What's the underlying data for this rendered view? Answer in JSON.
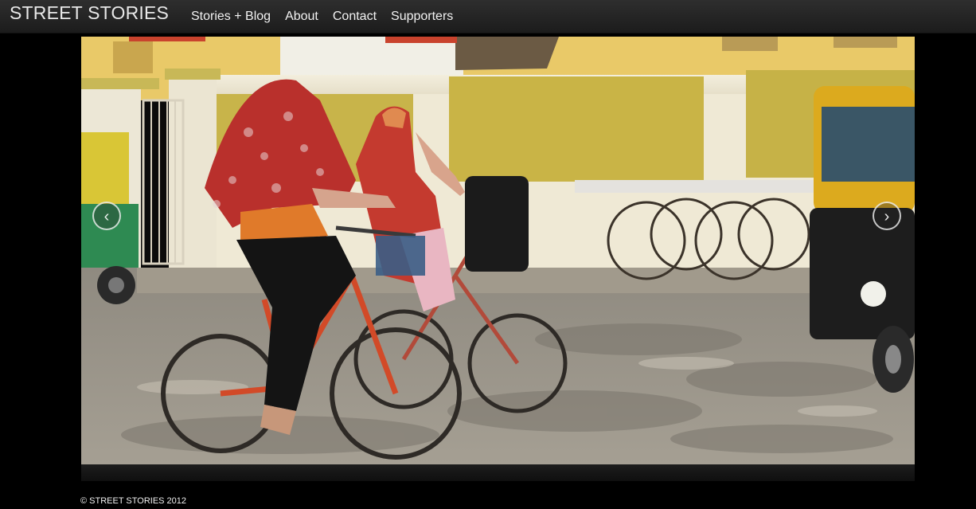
{
  "site": {
    "brand": "STREET STORIES"
  },
  "nav": {
    "items": [
      {
        "label": "Stories + Blog"
      },
      {
        "label": "About"
      },
      {
        "label": "Contact"
      },
      {
        "label": "Supporters"
      }
    ]
  },
  "slideshow": {
    "prev_glyph": "‹",
    "next_glyph": "›",
    "prev_icon": "chevron-left-icon",
    "next_icon": "chevron-right-icon"
  },
  "footer": {
    "copyright": "© STREET STORIES 2012"
  },
  "colors": {
    "background": "#000000",
    "navbar": "#262626",
    "text": "#f2f2f2"
  }
}
